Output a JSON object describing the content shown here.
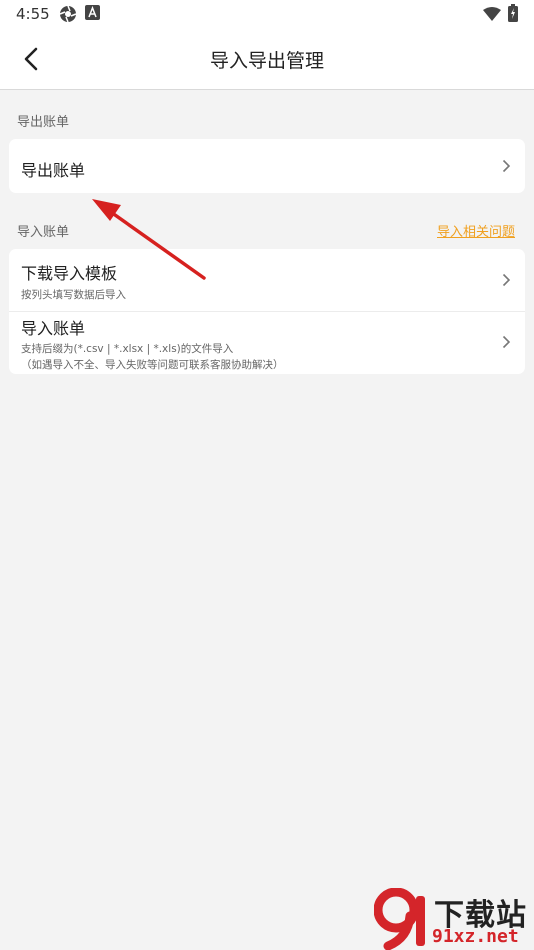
{
  "status_bar": {
    "time": "4:55",
    "icons": [
      "aperture-icon",
      "a-badge-icon",
      "wifi-icon",
      "battery-charging-icon"
    ]
  },
  "nav": {
    "title": "导入导出管理",
    "back_icon": "chevron-left-icon"
  },
  "export_section": {
    "label": "导出账单",
    "items": [
      {
        "title": "导出账单"
      }
    ]
  },
  "import_section": {
    "label": "导入账单",
    "link": "导入相关问题",
    "items": [
      {
        "title": "下载导入模板",
        "desc": "按列头填写数据后导入"
      },
      {
        "title": "导入账单",
        "desc1": "支持后缀为(*.csv | *.xlsx | *.xls)的文件导入",
        "desc2": "（如遇导入不全、导入失败等问题可联系客服协助解决）"
      }
    ]
  },
  "annotation": {
    "arrow_color": "#d6211f"
  },
  "watermark": {
    "top_text": "下载站",
    "bottom_text": "91xz.net",
    "logo": "91-logo"
  },
  "colors": {
    "link": "#f0a020",
    "background": "#f3f3f3"
  }
}
